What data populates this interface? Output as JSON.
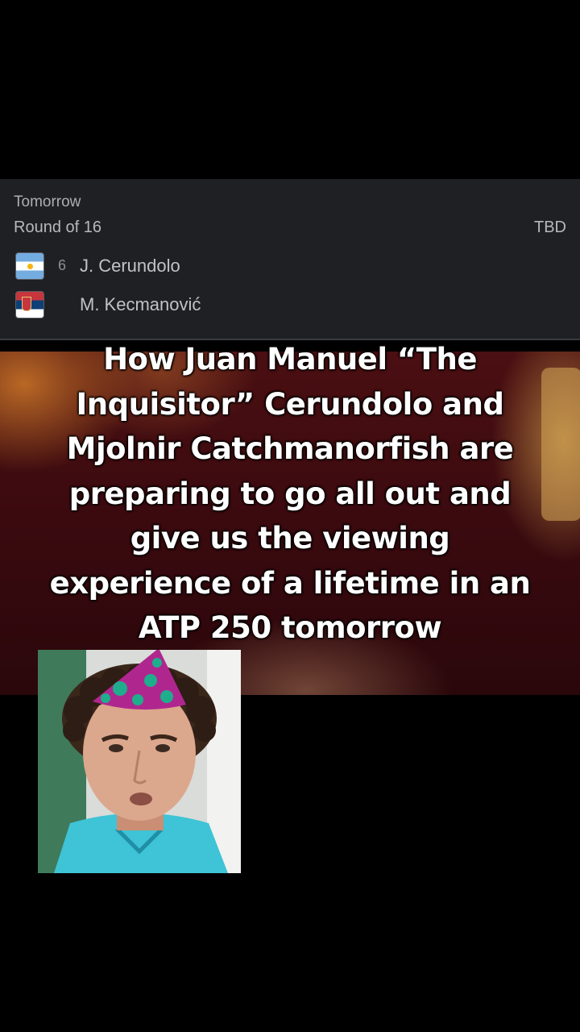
{
  "match": {
    "date": "Tomorrow",
    "round": "Round of 16",
    "status": "TBD",
    "players": [
      {
        "seed": "6",
        "name": "J. Cerundolo",
        "flag": "argentina-flag-icon"
      },
      {
        "seed": "",
        "name": "M. Kecmanović",
        "flag": "serbia-flag-icon"
      }
    ]
  },
  "caption": {
    "lines": [
      "How Juan Manuel “The",
      "Inquisitor” Cerundolo and",
      "Mjolnir Catchmanorfish are",
      "preparing to go all out and",
      "give us the viewing",
      "experience of a lifetime in an",
      "ATP 250 tomorrow"
    ]
  },
  "colors": {
    "card_bg": "#1f2024",
    "background_photo": "#3a0a0f",
    "party_hat": "#b0268f",
    "hat_dots": "#1eae8c",
    "shirt": "#3fc3d6"
  }
}
